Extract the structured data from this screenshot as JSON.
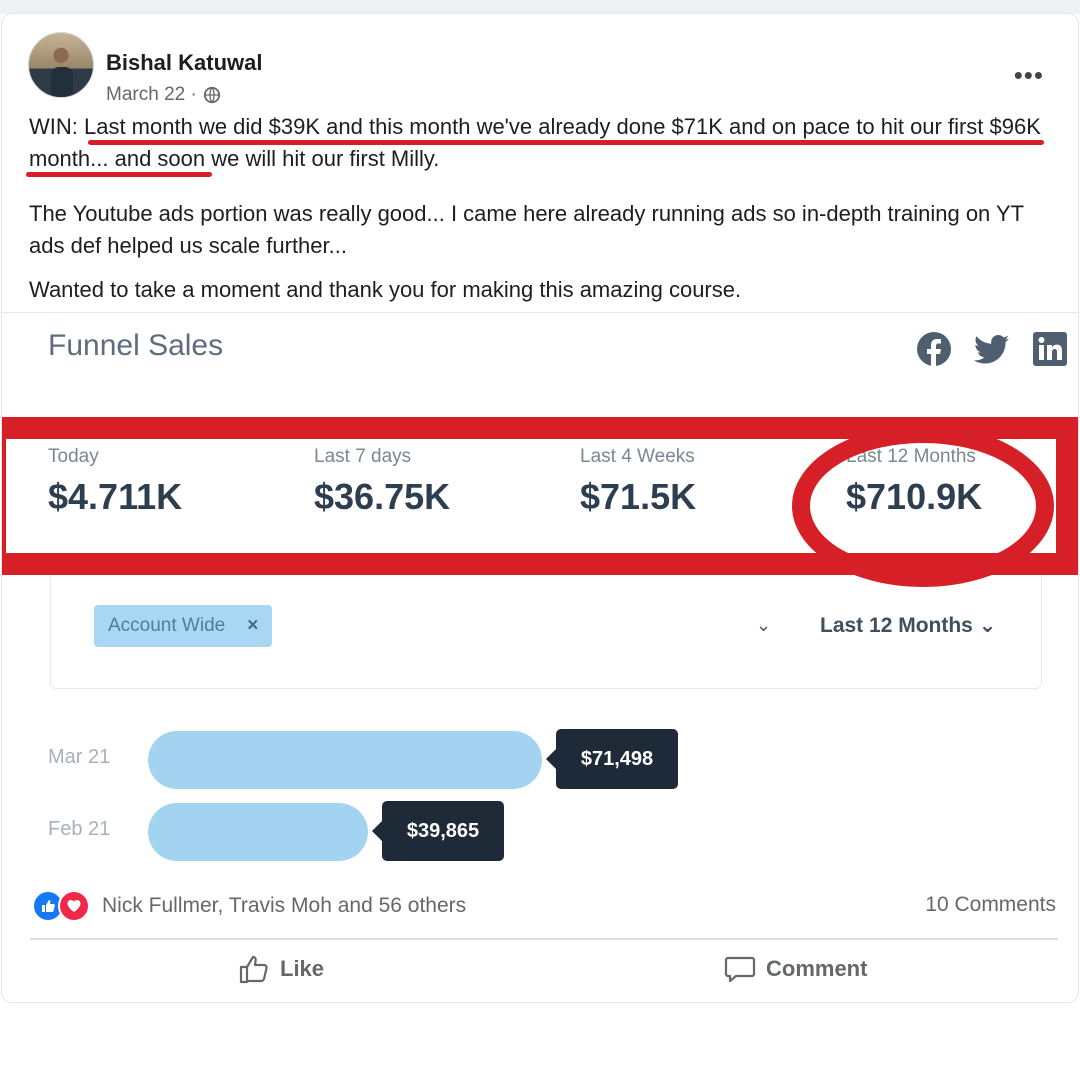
{
  "post": {
    "author": "Bishal Katuwal",
    "date": "March 22 ·",
    "text_line_1": "WIN:  Last month we did $39K and this month we've already done $71K and on pace to hit our first $96K month... and soon we will hit our first Milly.",
    "text_line_2": "The Youtube ads portion was really good... I came here already running ads so in-depth training on YT ads def helped us scale further...",
    "text_line_3": "Wanted to take a moment and thank you for making this amazing course."
  },
  "dashboard": {
    "title": "Funnel Sales",
    "stats": [
      {
        "label": "Today",
        "value": "$4.711K"
      },
      {
        "label": "Last 7 days",
        "value": "$36.75K"
      },
      {
        "label": "Last 4 Weeks",
        "value": "$71.5K"
      },
      {
        "label": "Last 12 Months",
        "value": "$710.9K"
      }
    ],
    "filter_chip": "Account Wide",
    "filter_chip_remove": "×",
    "period": "Last 12 Months ⌄",
    "dropdown_arrow": "⌄",
    "highlight_color": "#d61f26",
    "bar_color": "#a4d3f1"
  },
  "chart_data": {
    "type": "bar",
    "categories": [
      "Mar 21",
      "Feb 21"
    ],
    "values": [
      71498,
      39865
    ],
    "data_labels": [
      "$71,498",
      "$39,865"
    ],
    "orientation": "horizontal"
  },
  "footer": {
    "reactions_text": "Nick Fullmer, Travis Moh and 56 others",
    "comments_text": "10 Comments",
    "like_label": "Like",
    "comment_label": "Comment"
  },
  "icons": [
    "globe-icon",
    "more-icon",
    "facebook-icon",
    "twitter-icon",
    "linkedin-icon",
    "like-reaction-icon",
    "love-reaction-icon",
    "thumb-up-icon",
    "comment-bubble-icon"
  ]
}
